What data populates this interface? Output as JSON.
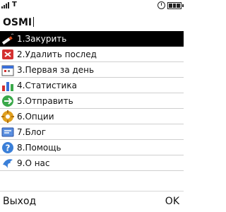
{
  "status": {
    "network": "T",
    "signal_level": 0.8,
    "battery_level": 1.0
  },
  "app": {
    "title": "OSMI"
  },
  "menu": {
    "selected_index": 0,
    "items": [
      {
        "label": "1.Закурить",
        "icon": "cigarette-icon"
      },
      {
        "label": "2.Удалить послед",
        "icon": "delete-icon"
      },
      {
        "label": "3.Первая за день",
        "icon": "calendar-icon"
      },
      {
        "label": "4.Статистика",
        "icon": "stats-chart-icon"
      },
      {
        "label": "5.Отправить",
        "icon": "send-icon"
      },
      {
        "label": "6.Опции",
        "icon": "options-icon"
      },
      {
        "label": "7.Блог",
        "icon": "blog-icon"
      },
      {
        "label": "8.Помощь",
        "icon": "help-icon"
      },
      {
        "label": "9.О нас",
        "icon": "about-icon"
      }
    ]
  },
  "softkeys": {
    "left": "Выход",
    "right": "OK"
  },
  "colors": {
    "selection_bg": "#000000",
    "selection_fg": "#ffffff"
  }
}
